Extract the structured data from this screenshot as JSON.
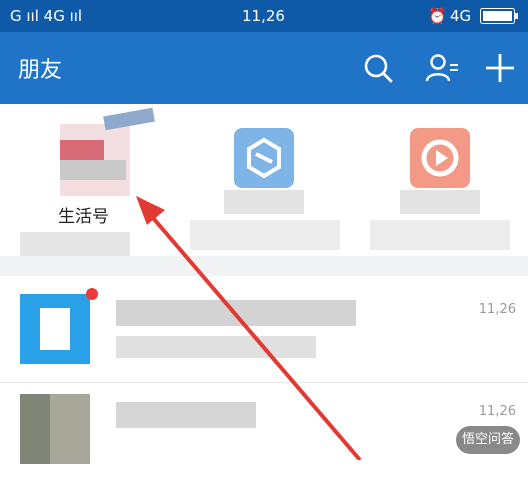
{
  "status_bar": {
    "left": "G ııl 4G ııl",
    "time": "11,26",
    "right": "4G"
  },
  "header": {
    "title": "朋友",
    "icons": [
      "search-icon",
      "add-friend-icon",
      "plus-icon"
    ]
  },
  "tiles": [
    {
      "label": "生活号"
    },
    {
      "label": ""
    },
    {
      "label": ""
    }
  ],
  "messages": [
    {
      "time": "11,26"
    },
    {
      "time": "11,26"
    }
  ],
  "watermark": "悟空问答",
  "colors": {
    "status_bar": "#0f5aa8",
    "app_bar": "#1f74c8",
    "arrow": "#e23a32"
  }
}
